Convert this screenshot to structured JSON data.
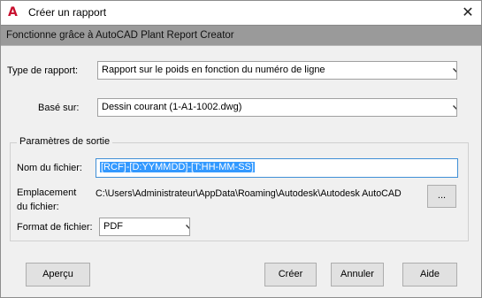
{
  "window": {
    "title": "Créer un rapport",
    "close_glyph": "✕",
    "app_icon": "autocad-a-icon"
  },
  "banner": {
    "text": "Fonctionne grâce à AutoCAD Plant Report Creator"
  },
  "report_type": {
    "label": "Type de rapport:",
    "value": "Rapport sur le poids en fonction du numéro de ligne"
  },
  "based_on": {
    "label": "Basé sur:",
    "value": "Dessin courant (1-A1-1002.dwg)"
  },
  "output": {
    "group_title": "Paramètres de sortie",
    "filename_label": "Nom du fichier:",
    "filename_value": "[RCF]-[D:YYMMDD]-[T:HH-MM-SS]",
    "location_label_line1": "Emplacement",
    "location_label_line2": "du fichier:",
    "location_value": "C:\\Users\\Administrateur\\AppData\\Roaming\\Autodesk\\Autodesk AutoCAD",
    "browse_label": "...",
    "format_label": "Format de fichier:",
    "format_value": "PDF"
  },
  "buttons": {
    "preview": "Aperçu",
    "create": "Créer",
    "cancel": "Annuler",
    "help": "Aide"
  }
}
